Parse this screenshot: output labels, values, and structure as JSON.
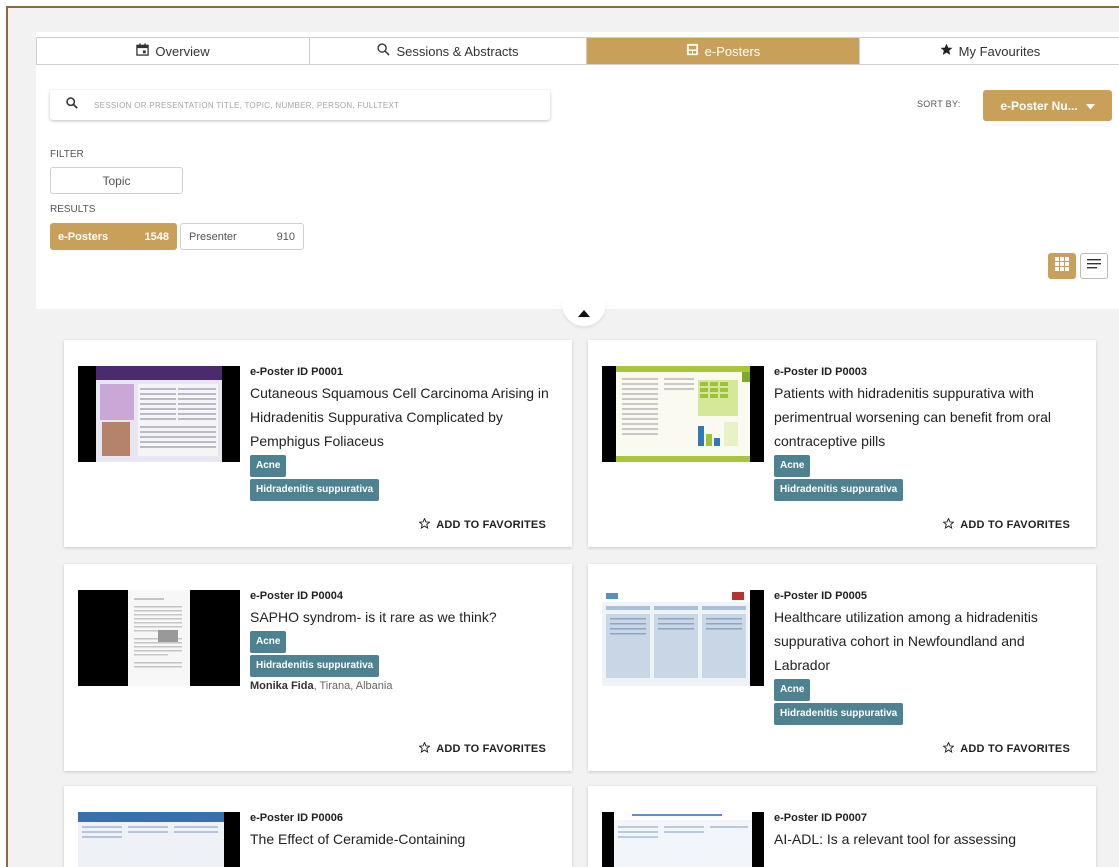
{
  "tabs": [
    {
      "label": "Overview",
      "icon": "calendar-icon",
      "active": false
    },
    {
      "label": "Sessions & Abstracts",
      "icon": "search-icon",
      "active": false
    },
    {
      "label": "e-Posters",
      "icon": "poster-icon",
      "active": true
    },
    {
      "label": "My Favourites",
      "icon": "star-icon",
      "active": false
    }
  ],
  "search": {
    "placeholder": "SESSION OR PRESENTATION TITLE, TOPIC, NUMBER, PERSON, FULLTEXT",
    "value": ""
  },
  "sort": {
    "label": "SORT BY:",
    "value": "e-Poster Nu..."
  },
  "filter": {
    "label": "FILTER",
    "topic_button": "Topic"
  },
  "results": {
    "label": "RESULTS",
    "eposters": {
      "label": "e-Posters",
      "count": "1548"
    },
    "presenter": {
      "label": "Presenter",
      "count": "910"
    }
  },
  "favorite_label": "ADD TO FAVORITES",
  "colors": {
    "accent": "#c9a05a",
    "tag": "#4e8291"
  },
  "cards": [
    {
      "id": "e-Poster ID P0001",
      "title": "Cutaneous Squamous Cell Carcinoma Arising in Hidradenitis Suppurativa Complicated by Pemphigus Foliaceus",
      "tags": [
        "Acne",
        "Hidradenitis suppurativa"
      ],
      "author_name": "",
      "author_place": ""
    },
    {
      "id": "e-Poster ID P0003",
      "title": "Patients with hidradenitis suppurativa with perimentrual worsening can benefit from oral contraceptive pills",
      "tags": [
        "Acne",
        "Hidradenitis suppurativa"
      ],
      "author_name": "",
      "author_place": ""
    },
    {
      "id": "e-Poster ID P0004",
      "title": "SAPHO syndrom- is it rare as we think?",
      "tags": [
        "Acne",
        "Hidradenitis suppurativa"
      ],
      "author_name": "Monika Fida",
      "author_place": ", Tirana, Albania"
    },
    {
      "id": "e-Poster ID P0005",
      "title": "Healthcare utilization among a hidradenitis suppurativa cohort in Newfoundland and Labrador",
      "tags": [
        "Acne",
        "Hidradenitis suppurativa"
      ],
      "author_name": "",
      "author_place": ""
    },
    {
      "id": "e-Poster ID P0006",
      "title": "The Effect of Ceramide-Containing",
      "tags": [],
      "author_name": "",
      "author_place": ""
    },
    {
      "id": "e-Poster ID P0007",
      "title": "AI-ADL: Is a relevant tool for assessing",
      "tags": [],
      "author_name": "",
      "author_place": ""
    }
  ]
}
